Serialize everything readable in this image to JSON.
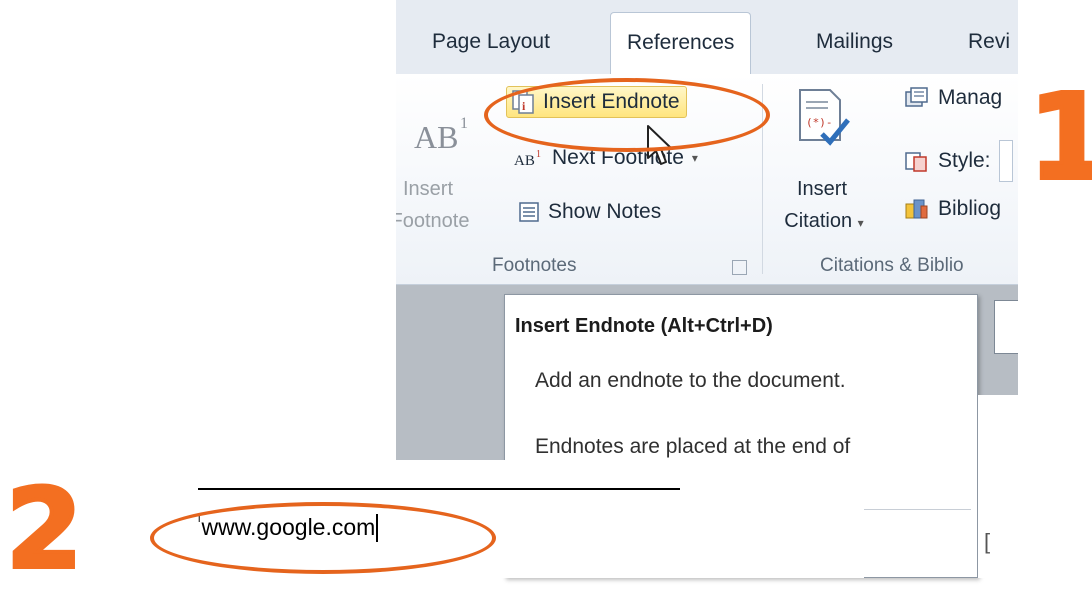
{
  "ribbon": {
    "tabs": [
      "Page Layout",
      "References",
      "Mailings",
      "Revi"
    ],
    "active_tab": "References",
    "footnotes_group": {
      "insert_footnote_label_1": "Insert",
      "insert_footnote_label_2": "Footnote",
      "insert_endnote_label": "Insert Endnote",
      "next_footnote_label": "Next Footnote",
      "show_notes_label": "Show Notes",
      "group_label": "Footnotes"
    },
    "citations_group": {
      "insert_citation_label_1": "Insert",
      "insert_citation_label_2": "Citation",
      "manage_label": "Manag",
      "style_label": "Style:",
      "bibliography_label": "Bibliog",
      "group_label": "Citations & Biblio"
    }
  },
  "tooltip": {
    "title": "Insert Endnote (Alt+Ctrl+D)",
    "line1": "Add an endnote to the document.",
    "line2": "Endnotes are placed at the end of"
  },
  "document": {
    "endnote_marker": "i",
    "endnote_text": "www.google.com"
  },
  "steps": {
    "step1": "1",
    "step2": "2"
  },
  "colors": {
    "accent_orange": "#f36f21",
    "highlight": "#ffe57f"
  },
  "icons": [
    "ab-superscript-icon",
    "insert-endnote-icon",
    "next-footnote-icon",
    "show-notes-icon",
    "insert-citation-icon",
    "manage-sources-icon",
    "style-icon",
    "bibliography-icon",
    "mouse-cursor-icon"
  ]
}
